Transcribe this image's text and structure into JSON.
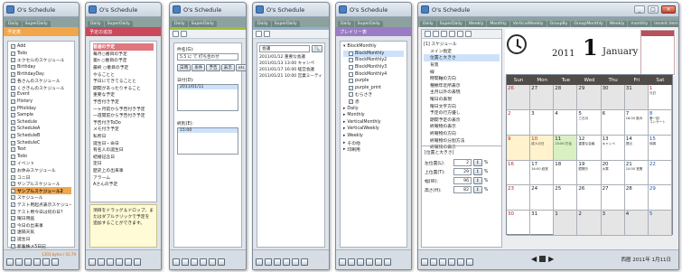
{
  "app_title": "O's Schedule",
  "tabs": [
    "Daily",
    "SuperDaily",
    "Weekly",
    "Monthly",
    "VerticalWeekly",
    "GroupBy"
  ],
  "tabs_right": [
    "GroupMonthly",
    "Weekly",
    "monthly",
    "recent items",
    "BlockMonthly"
  ],
  "win1": {
    "header": "予定表",
    "items": [
      "Add",
      "Todo",
      "エクセルのスケジュール",
      "Birthday",
      "BirthdayDay",
      "各さんのスケジュール",
      "くさきんのスケジュール",
      "Event",
      "History",
      "PHoliday",
      "Sample",
      "Schedule",
      "ScheduleA",
      "ScheduleB",
      "ScheduleC",
      "Text",
      "Todo",
      "イベント",
      "お休みスケジュール",
      "コニ日",
      "サンプルスケジュール",
      "サンプルスケジュール2",
      "スケジュール",
      "テスト用起点表示スケジュール",
      "テスト用今日は何の日?",
      "曜日用画",
      "今日の出来事",
      "遠隔天気",
      "誕生日",
      "新着株メ5日記",
      "有名人の誕生日"
    ],
    "selected_index": 21,
    "status": "1303 bytes / 43.79"
  },
  "win2": {
    "header": "予定の追加",
    "items": [
      "普通の予定",
      "毎月○番目の予定",
      "第n ○番目の予定",
      "最終 ○番目の予定",
      "やることと",
      "予日にできてることと",
      "期間があったりすること",
      "重要な予定",
      "予告付き予定",
      "一ヶ月前から予告付き予定",
      "一週間前から予告付き予定",
      "予告付きToDo",
      "メモ付き予定",
      "私所日",
      "誕生日・命日",
      "有名人の誕生日",
      "結婚記念日",
      "定日",
      "歴史上の出来事",
      "アラーム",
      "Aさんの予定"
    ],
    "note": "項目をドラッグ＆ドロップ、またはダブルクリックで予定を追加することができます。"
  },
  "win3": {
    "name_label": "件名(G):",
    "name_value": "5.5 に て 打ち合わせ",
    "tabs": [
      "日時",
      "条件",
      "予告",
      "表示",
      "etc"
    ],
    "date_label": "日付(D):",
    "date_value": "2011/01/11",
    "end_label": "終別(E):",
    "end_value": "15:00"
  },
  "win4": {
    "search_value": "会議",
    "results": [
      "2011/01/12 重要な会議",
      "2011/01/13 13:00 キャンペ",
      "2011/01/17 16:00 経営会議",
      "2011/01/21 10:00 営業ミーティ"
    ]
  },
  "win5": {
    "header": "プレイリー表",
    "items": [
      "BlockMonthly",
      "BlockMonthly",
      "BlockMonthly2",
      "BlockMonthly3",
      "BlockMonthly4",
      "purple",
      "purple_print",
      "むらさき",
      "赤",
      "Daily",
      "Monthly",
      "VerticalMonthly",
      "VerticalWeekly",
      "Weekly",
      "その他",
      "印刷用"
    ]
  },
  "win6": {
    "tree_header": "[1] スケジュール",
    "tree_items": [
      "メイン指定",
      "位置と大きさ",
      "背景",
      "線",
      "時間軸の方向",
      "種類年近所表示",
      "主月以外の表現",
      "曜日の表現",
      "曜日文字方向",
      "予定の行方優し",
      "期間予定の表示",
      "終曜物の表示",
      "終曜物の方向",
      "終曜物の分割方法",
      "終曜物の表示"
    ],
    "pos_header": "[位置と大きさ]",
    "fields": [
      {
        "label": "左位置(L):",
        "value": "2"
      },
      {
        "label": "上位置(T):",
        "value": "29"
      },
      {
        "label": "幅(W):",
        "value": "96"
      },
      {
        "label": "高さ(H):",
        "value": "82"
      }
    ],
    "unit": "%",
    "year": "2011",
    "day": "1",
    "month": "January",
    "weekdays": [
      "Sun",
      "Mon",
      "Tue",
      "Wed",
      "Thu",
      "Fri",
      "Sat"
    ],
    "footer_date": "西暦 2011年 1月11日"
  },
  "calendar": [
    {
      "d": "26",
      "c": "other"
    },
    {
      "d": "27",
      "c": "other"
    },
    {
      "d": "28",
      "c": "other"
    },
    {
      "d": "29",
      "c": "other"
    },
    {
      "d": "30",
      "c": "other"
    },
    {
      "d": "31",
      "c": "other"
    },
    {
      "d": "1",
      "c": "hol",
      "ev": [
        "元日"
      ]
    },
    {
      "d": "2",
      "c": "sun"
    },
    {
      "d": "3",
      "c": ""
    },
    {
      "d": "4",
      "c": ""
    },
    {
      "d": "5",
      "c": "",
      "ev": [
        "三日月"
      ]
    },
    {
      "d": "6",
      "c": ""
    },
    {
      "d": "7",
      "c": "",
      "ev": [
        "18:00 飲み"
      ]
    },
    {
      "d": "8",
      "c": "sat",
      "ev": [
        "第一回",
        "コンサート"
      ]
    },
    {
      "d": "9",
      "c": "sun"
    },
    {
      "d": "10",
      "c": "hol",
      "ev": [
        "成人の日"
      ]
    },
    {
      "d": "11",
      "c": "",
      "ev": [
        "15:00 打合"
      ]
    },
    {
      "d": "12",
      "c": "",
      "ev": [
        "重要な会議"
      ]
    },
    {
      "d": "13",
      "c": "",
      "ev": [
        "キャンペ"
      ]
    },
    {
      "d": "14",
      "c": "",
      "ev": [
        "提出"
      ]
    },
    {
      "d": "15",
      "c": "sat",
      "ev": [
        "体調"
      ]
    },
    {
      "d": "16",
      "c": "sun"
    },
    {
      "d": "17",
      "c": "",
      "ev": [
        "16:00 経営"
      ]
    },
    {
      "d": "18",
      "c": ""
    },
    {
      "d": "19",
      "c": "",
      "ev": [
        "鏡開き"
      ]
    },
    {
      "d": "20",
      "c": "",
      "ev": [
        "大寒"
      ]
    },
    {
      "d": "21",
      "c": "",
      "ev": [
        "10:00 営業"
      ]
    },
    {
      "d": "22",
      "c": "sat"
    },
    {
      "d": "23",
      "c": "sun"
    },
    {
      "d": "24",
      "c": ""
    },
    {
      "d": "25",
      "c": ""
    },
    {
      "d": "26",
      "c": ""
    },
    {
      "d": "27",
      "c": ""
    },
    {
      "d": "28",
      "c": ""
    },
    {
      "d": "29",
      "c": "sat"
    },
    {
      "d": "30",
      "c": "sun"
    },
    {
      "d": "31",
      "c": ""
    },
    {
      "d": "1",
      "c": "other"
    },
    {
      "d": "2",
      "c": "other"
    },
    {
      "d": "3",
      "c": "other"
    },
    {
      "d": "4",
      "c": "other"
    },
    {
      "d": "5",
      "c": "other"
    }
  ]
}
